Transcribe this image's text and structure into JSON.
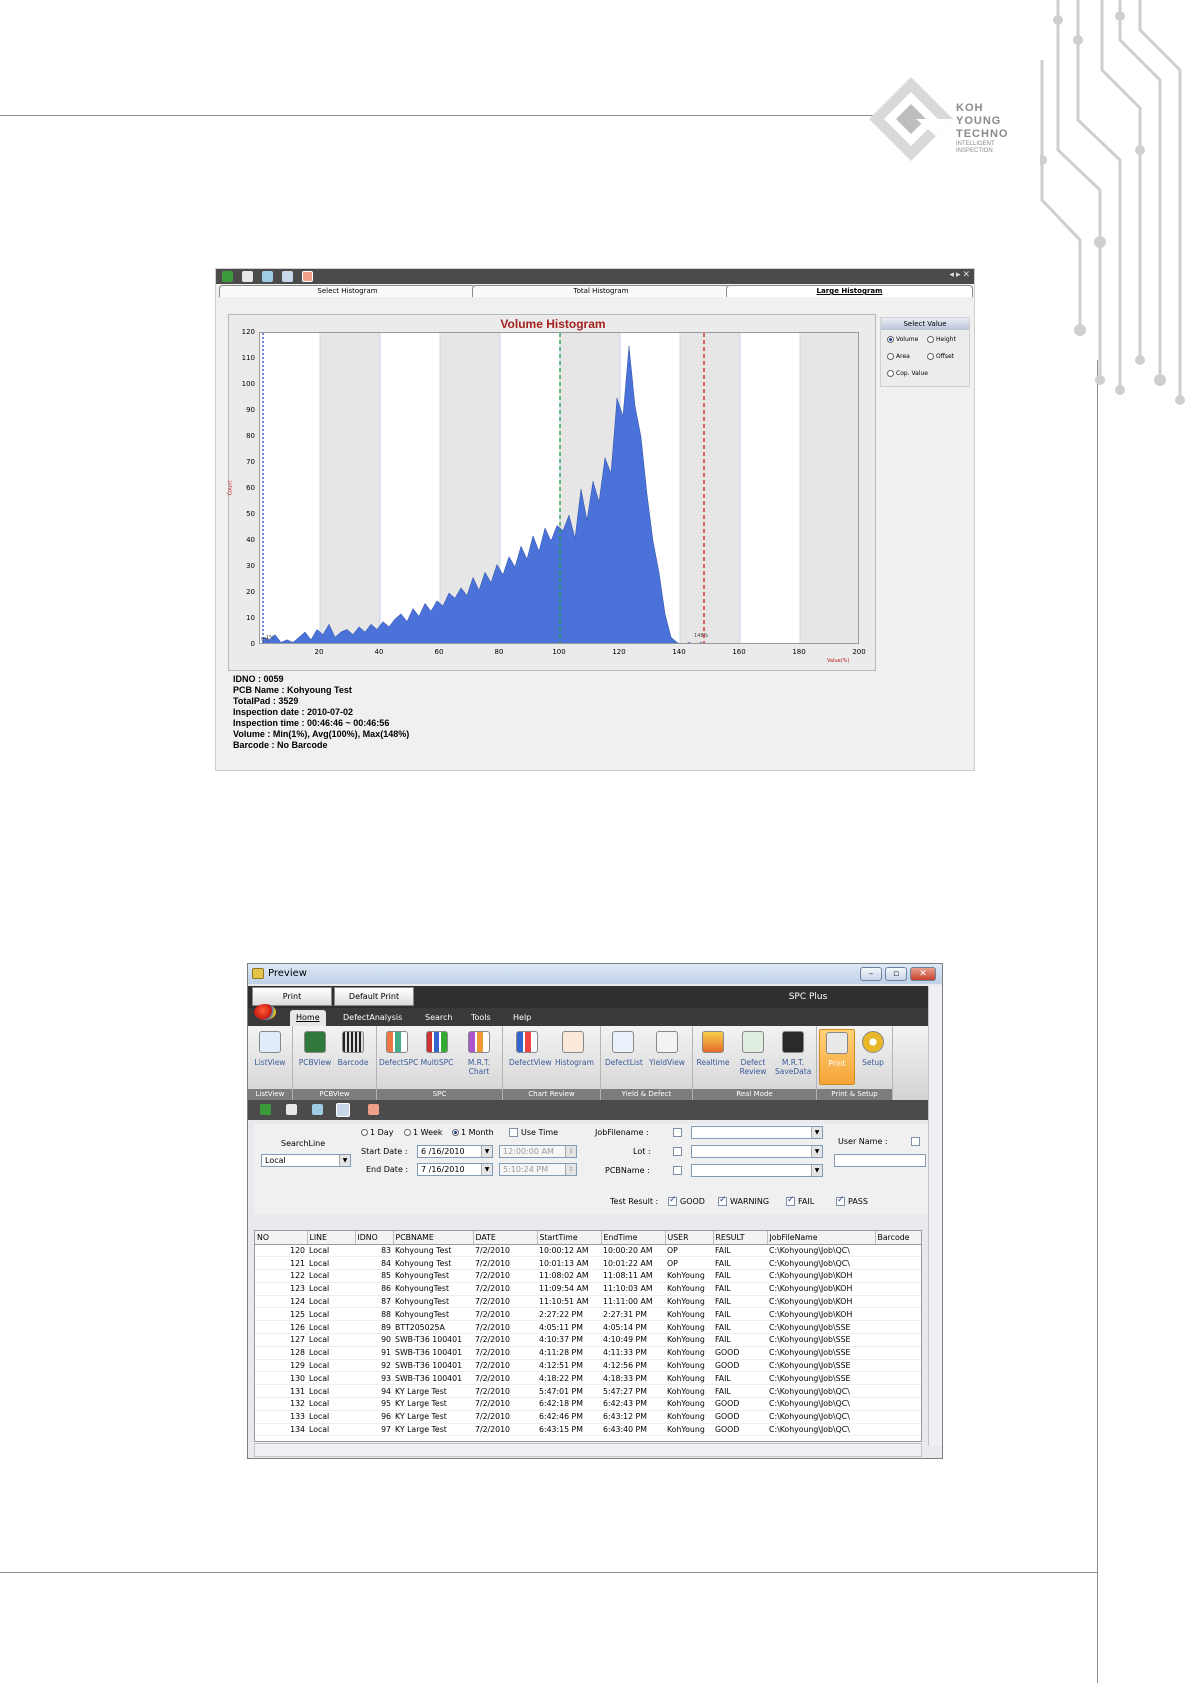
{
  "logo": {
    "line1": "KOH",
    "line2": "YOUNG",
    "line3": "TECHNO",
    "sub1": "INTELLIGENT",
    "sub2": "INSPECTION"
  },
  "shot1": {
    "tabs": [
      "Select Histogram",
      "Total Histogram",
      "Large Histogram"
    ],
    "active_tab": 2,
    "select_value": {
      "title": "Select Value",
      "options": [
        "Volume",
        "Height",
        "Area",
        "Offset",
        "Cop. Value"
      ],
      "selected": "Volume"
    },
    "info": [
      "IDNO : 0059",
      "PCB Name : Kohyoung Test",
      "TotalPad : 3529",
      "Inspection date : 2010-07-02",
      "Inspection time : 00:46:46 ~ 00:46:56",
      "Volume :  Min(1%),  Avg(100%), Max(148%)",
      "Barcode : No Barcode"
    ]
  },
  "chart_data": {
    "type": "area",
    "title": "Volume Histogram",
    "xlabel": "Value(%)",
    "ylabel": "Count",
    "xlim": [
      0,
      200
    ],
    "ylim": [
      0,
      120
    ],
    "x_ticks": [
      20,
      40,
      60,
      80,
      100,
      120,
      140,
      160,
      180,
      200
    ],
    "y_ticks": [
      0,
      10,
      20,
      30,
      40,
      50,
      60,
      70,
      80,
      90,
      100,
      110,
      120
    ],
    "markers": [
      {
        "x": 1,
        "color": "#2a3fd6",
        "style": "dotted"
      },
      {
        "x": 100,
        "color": "#1aa03a",
        "style": "dashed"
      },
      {
        "x": 148,
        "color": "#d01c1c",
        "style": "dashed"
      }
    ],
    "marker_labels": [
      "0%",
      "1%",
      "148%"
    ],
    "x": [
      1,
      3,
      5,
      7,
      9,
      11,
      13,
      15,
      17,
      19,
      21,
      23,
      25,
      27,
      29,
      31,
      33,
      35,
      37,
      39,
      41,
      43,
      45,
      47,
      49,
      51,
      53,
      55,
      57,
      59,
      61,
      63,
      65,
      67,
      69,
      71,
      73,
      75,
      77,
      79,
      81,
      83,
      85,
      87,
      89,
      91,
      93,
      95,
      97,
      99,
      101,
      103,
      105,
      107,
      109,
      111,
      113,
      115,
      117,
      119,
      121,
      123,
      125,
      127,
      129,
      131,
      133,
      135,
      137,
      139,
      141,
      143,
      145,
      147,
      149
    ],
    "values": [
      3,
      2,
      4,
      1,
      2,
      1,
      3,
      5,
      2,
      6,
      4,
      8,
      3,
      5,
      6,
      4,
      7,
      5,
      8,
      6,
      9,
      7,
      10,
      12,
      9,
      14,
      11,
      16,
      13,
      17,
      15,
      20,
      18,
      22,
      19,
      26,
      21,
      28,
      24,
      31,
      27,
      34,
      30,
      38,
      33,
      42,
      36,
      45,
      40,
      46,
      44,
      50,
      41,
      60,
      48,
      63,
      55,
      72,
      66,
      95,
      88,
      115,
      92,
      80,
      58,
      40,
      28,
      12,
      3,
      1,
      0,
      1,
      0,
      1,
      0
    ]
  },
  "shot2": {
    "window_title": "Preview",
    "buttons": {
      "print": "Print",
      "default_print": "Default Print"
    },
    "app_name": "SPC Plus",
    "menus": [
      "Home",
      "DefectAnalysis",
      "Search",
      "Tools",
      "Help"
    ],
    "ribbon_groups": [
      {
        "label": "ListView",
        "items": [
          "ListView"
        ]
      },
      {
        "label": "PCBView",
        "items": [
          "PCBView",
          "Barcode"
        ]
      },
      {
        "label": "SPC",
        "items": [
          "DefectSPC",
          "MultiSPC",
          "M.R.T. Chart"
        ]
      },
      {
        "label": "Chart Review",
        "items": [
          "DefectView",
          "Histogram"
        ]
      },
      {
        "label": "Yield & Defect",
        "items": [
          "DefectList",
          "YieldView"
        ]
      },
      {
        "label": "Real Mode",
        "items": [
          "Realtime",
          "Defect Review",
          "M.R.T. SaveData"
        ]
      },
      {
        "label": "Print & Setup",
        "items": [
          "Print",
          "Setup"
        ]
      }
    ],
    "filter": {
      "searchline_label": "SearchLine",
      "searchline_value": "Local",
      "period": [
        "1 Day",
        "1 Week",
        "1 Month"
      ],
      "period_selected": "1 Month",
      "use_time": "Use Time",
      "start_date_label": "Start Date :",
      "start_date": "6 /16/2010",
      "start_time": "12:00:00 AM",
      "end_date_label": "End Date :",
      "end_date": "7 /16/2010",
      "end_time": "5:10:24 PM",
      "jobfile_label": "JobFilename :",
      "lot_label": "Lot :",
      "pcbname_label": "PCBName :",
      "username_label": "User Name :"
    },
    "test_result": {
      "label": "Test Result :",
      "options": [
        "GOOD",
        "WARNING",
        "FAIL",
        "PASS"
      ]
    },
    "columns": [
      "NO",
      "LINE",
      "IDNO",
      "PCBNAME",
      "DATE",
      "StartTime",
      "EndTime",
      "USER",
      "RESULT",
      "JobFileName",
      "Barcode"
    ],
    "rows": [
      [
        "120",
        "Local",
        "83",
        "Kohyoung Test",
        "7/2/2010",
        "10:00:12 AM",
        "10:00:20 AM",
        "OP",
        "FAIL",
        "C:\\Kohyoung\\Job\\QC\\",
        ""
      ],
      [
        "121",
        "Local",
        "84",
        "Kohyoung Test",
        "7/2/2010",
        "10:01:13 AM",
        "10:01:22 AM",
        "OP",
        "FAIL",
        "C:\\Kohyoung\\Job\\QC\\",
        ""
      ],
      [
        "122",
        "Local",
        "85",
        "KohyoungTest",
        "7/2/2010",
        "11:08:02 AM",
        "11:08:11 AM",
        "KohYoung",
        "FAIL",
        "C:\\Kohyoung\\Job\\KOH",
        ""
      ],
      [
        "123",
        "Local",
        "86",
        "KohyoungTest",
        "7/2/2010",
        "11:09:54 AM",
        "11:10:03 AM",
        "KohYoung",
        "FAIL",
        "C:\\Kohyoung\\Job\\KOH",
        ""
      ],
      [
        "124",
        "Local",
        "87",
        "KohyoungTest",
        "7/2/2010",
        "11:10:51 AM",
        "11:11:00 AM",
        "KohYoung",
        "FAIL",
        "C:\\Kohyoung\\Job\\KOH",
        ""
      ],
      [
        "125",
        "Local",
        "88",
        "KohyoungTest",
        "7/2/2010",
        "2:27:22 PM",
        "2:27:31 PM",
        "KohYoung",
        "FAIL",
        "C:\\Kohyoung\\Job\\KOH",
        ""
      ],
      [
        "126",
        "Local",
        "89",
        "BTT205025A",
        "7/2/2010",
        "4:05:11 PM",
        "4:05:14 PM",
        "KohYoung",
        "FAIL",
        "C:\\Kohyoung\\Job\\SSE",
        ""
      ],
      [
        "127",
        "Local",
        "90",
        "SWB-T36 100401",
        "7/2/2010",
        "4:10:37 PM",
        "4:10:49 PM",
        "KohYoung",
        "FAIL",
        "C:\\Kohyoung\\Job\\SSE",
        ""
      ],
      [
        "128",
        "Local",
        "91",
        "SWB-T36 100401",
        "7/2/2010",
        "4:11:28 PM",
        "4:11:33 PM",
        "KohYoung",
        "GOOD",
        "C:\\Kohyoung\\Job\\SSE",
        ""
      ],
      [
        "129",
        "Local",
        "92",
        "SWB-T36 100401",
        "7/2/2010",
        "4:12:51 PM",
        "4:12:56 PM",
        "KohYoung",
        "GOOD",
        "C:\\Kohyoung\\Job\\SSE",
        ""
      ],
      [
        "130",
        "Local",
        "93",
        "SWB-T36 100401",
        "7/2/2010",
        "4:18:22 PM",
        "4:18:33 PM",
        "KohYoung",
        "FAIL",
        "C:\\Kohyoung\\Job\\SSE",
        ""
      ],
      [
        "131",
        "Local",
        "94",
        "KY Large Test",
        "7/2/2010",
        "5:47:01 PM",
        "5:47:27 PM",
        "KohYoung",
        "FAIL",
        "C:\\Kohyoung\\Job\\QC\\",
        ""
      ],
      [
        "132",
        "Local",
        "95",
        "KY Large Test",
        "7/2/2010",
        "6:42:18 PM",
        "6:42:43 PM",
        "KohYoung",
        "GOOD",
        "C:\\Kohyoung\\Job\\QC\\",
        ""
      ],
      [
        "133",
        "Local",
        "96",
        "KY Large Test",
        "7/2/2010",
        "6:42:46 PM",
        "6:43:12 PM",
        "KohYoung",
        "GOOD",
        "C:\\Kohyoung\\Job\\QC\\",
        ""
      ],
      [
        "134",
        "Local",
        "97",
        "KY Large Test",
        "7/2/2010",
        "6:43:15 PM",
        "6:43:40 PM",
        "KohYoung",
        "GOOD",
        "C:\\Kohyoung\\Job\\QC\\",
        ""
      ]
    ]
  },
  "colors": {
    "histogram_fill": "#4a72d8",
    "title_red": "#a3201e",
    "gridband": "#e6e6e6"
  }
}
